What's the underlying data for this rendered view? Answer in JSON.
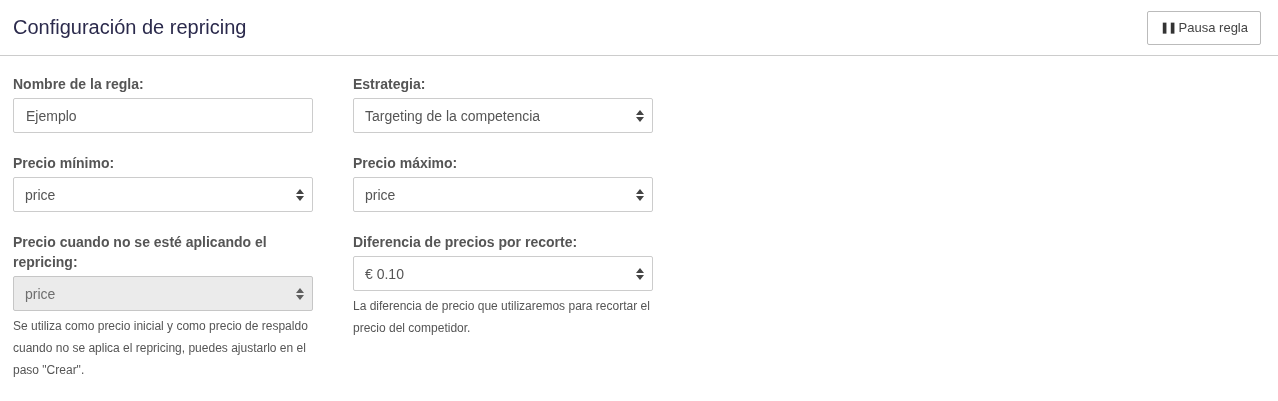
{
  "header": {
    "title": "Configuración de repricing",
    "pause_button": {
      "icon": "❚❚",
      "label": "Pausa regla"
    }
  },
  "fields": [
    {
      "label": "Nombre de la regla:",
      "kind": "text",
      "value": "Ejemplo",
      "disabled": false
    },
    {
      "label": "Estrategia:",
      "kind": "select",
      "value": "Targeting de la competencia",
      "disabled": false
    },
    {
      "label": "Precio mínimo:",
      "kind": "select",
      "value": "price",
      "disabled": false
    },
    {
      "label": "Precio máximo:",
      "kind": "select",
      "value": "price",
      "disabled": false
    },
    {
      "label": "Precio cuando no se esté aplicando el repricing:",
      "kind": "select",
      "value": "price",
      "disabled": true,
      "help": "Se utiliza como precio inicial y como precio de respaldo cuando no se aplica el repricing, puedes ajustarlo en el paso \"Crear\"."
    },
    {
      "label": "Diferencia de precios por recorte:",
      "kind": "select",
      "value": "€ 0.10",
      "disabled": false,
      "help": "La diferencia de precio que utilizaremos para recortar el precio del competidor."
    }
  ]
}
